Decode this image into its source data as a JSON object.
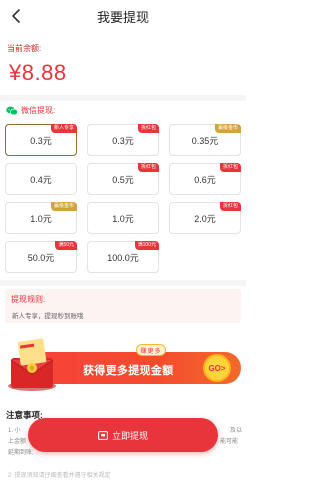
{
  "header": {
    "title": "我要提现",
    "back_icon": "chevron-left-icon"
  },
  "balance": {
    "label": "当前余额:",
    "value": "¥8.88"
  },
  "wechat": {
    "label": "微信提现:",
    "icon": "wechat-icon",
    "color": "#07c160"
  },
  "options": [
    {
      "value": "0.3元",
      "badge": "新人专享",
      "badge_color": "red",
      "selected": true
    },
    {
      "value": "0.3元",
      "badge": "拆红包",
      "badge_color": "red",
      "selected": false
    },
    {
      "value": "0.35元",
      "badge": "赢级金币",
      "badge_color": "gold",
      "selected": false
    },
    {
      "value": "0.4元",
      "badge": "",
      "badge_color": "",
      "selected": false
    },
    {
      "value": "0.5元",
      "badge": "拆红包",
      "badge_color": "red",
      "selected": false
    },
    {
      "value": "0.6元",
      "badge": "拆红包",
      "badge_color": "red",
      "selected": false
    },
    {
      "value": "1.0元",
      "badge": "赢级金币",
      "badge_color": "gold",
      "selected": false
    },
    {
      "value": "1.0元",
      "badge": "",
      "badge_color": "",
      "selected": false
    },
    {
      "value": "2.0元",
      "badge": "拆红包",
      "badge_color": "red",
      "selected": false
    },
    {
      "value": "50.0元",
      "badge": "满50元",
      "badge_color": "red",
      "selected": false
    },
    {
      "value": "100.0元",
      "badge": "满100元",
      "badge_color": "red",
      "selected": false
    }
  ],
  "rules": {
    "title": "提现规则:",
    "text": "新人专享，提现秒到账哦"
  },
  "banner": {
    "pill": "赚更多",
    "text": "获得更多提现金额",
    "go": "GO>"
  },
  "notes": {
    "title": "注意事项:",
    "line1a": "1. 小",
    "line1b": "及以",
    "line2a": "上金额",
    "line2b": "能可能",
    "line3": "延期到账;",
    "line4": "2. 提现须知请仔细查看并遵守相关规定"
  },
  "bottom_button": {
    "label": "立即提现",
    "icon": "wallet-icon"
  },
  "colors": {
    "accent": "#e8343b",
    "gold": "#d4a23c"
  }
}
